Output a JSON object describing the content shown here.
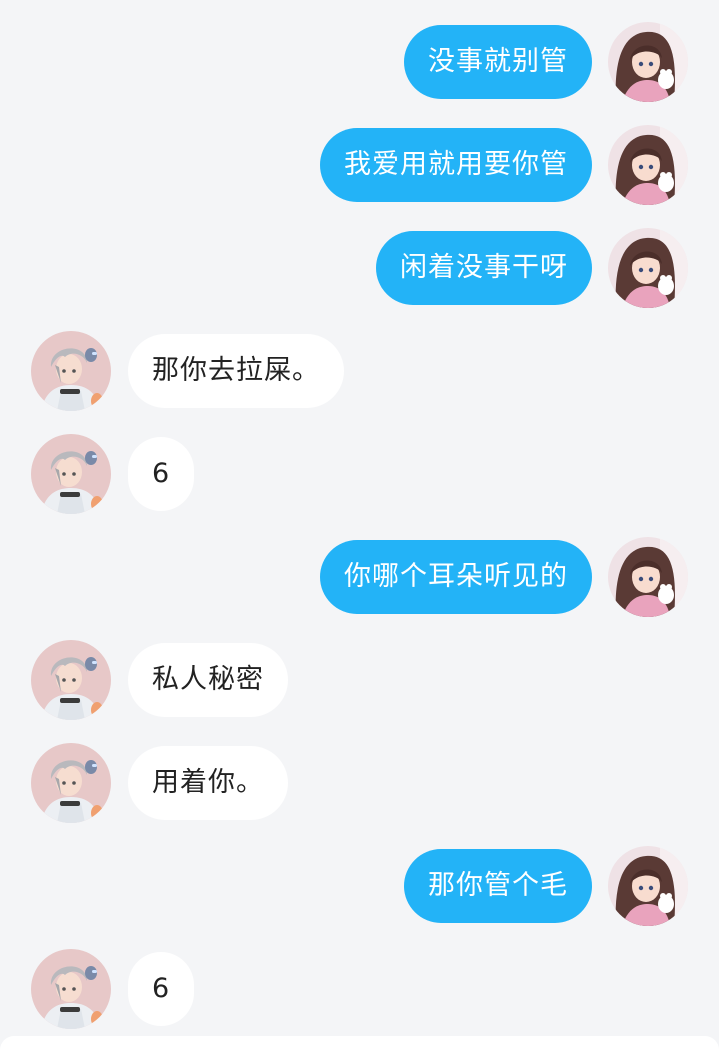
{
  "messages": [
    {
      "side": "out",
      "text": "没事就别管"
    },
    {
      "side": "out",
      "text": "我爱用就用要你管"
    },
    {
      "side": "out",
      "text": "闲着没事干呀"
    },
    {
      "side": "in",
      "text": "那你去拉屎。"
    },
    {
      "side": "in",
      "text": "6"
    },
    {
      "side": "out",
      "text": "你哪个耳朵听见的"
    },
    {
      "side": "in",
      "text": "私人秘密"
    },
    {
      "side": "in",
      "text": "用着你。"
    },
    {
      "side": "out",
      "text": "那你管个毛"
    },
    {
      "side": "in",
      "text": "6"
    }
  ],
  "colors": {
    "outgoing_bubble": "#23b3f7",
    "incoming_bubble": "#ffffff",
    "background": "#f4f5f7"
  },
  "icons": {
    "self_avatar": "anime-girl-avatar-icon",
    "other_avatar": "anime-boy-avatar-icon"
  }
}
